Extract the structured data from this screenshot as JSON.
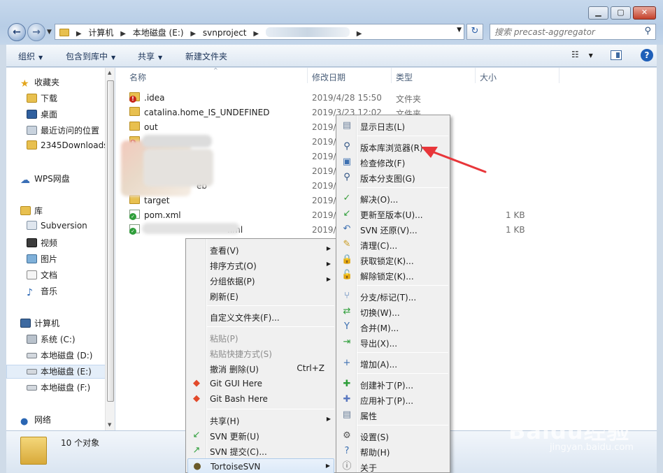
{
  "window": {
    "min": "▁",
    "max": "▢",
    "close": "✕"
  },
  "address": {
    "crumbs": [
      "计算机",
      "本地磁盘 (E:)",
      "svnproject"
    ],
    "search_placeholder": "搜索 precast-aggregator"
  },
  "toolbar": {
    "organize": "组织",
    "include": "包含到库中",
    "share": "共享",
    "new_folder": "新建文件夹"
  },
  "nav": {
    "favorites": "收藏夹",
    "downloads": "下载",
    "desktop": "桌面",
    "recent": "最近访问的位置",
    "dl2345": "2345Downloads",
    "wps": "WPS网盘",
    "libraries": "库",
    "subversion": "Subversion",
    "videos": "视频",
    "pictures": "图片",
    "documents": "文档",
    "music": "音乐",
    "computer": "计算机",
    "drive_c": "系统 (C:)",
    "drive_d": "本地磁盘 (D:)",
    "drive_e": "本地磁盘 (E:)",
    "drive_f": "本地磁盘 (F:)",
    "network": "网络"
  },
  "columns": {
    "name": "名称",
    "date": "修改日期",
    "type": "类型",
    "size": "大小"
  },
  "files": [
    {
      "name": ".idea",
      "date": "2019/4/28 15:50",
      "type": "文件夹",
      "size": "",
      "status": "modified"
    },
    {
      "name": "catalina.home_IS_UNDEFINED",
      "date": "2019/3/23 12:02",
      "type": "文件夹",
      "size": "",
      "status": "none"
    },
    {
      "name": "out",
      "date": "2019/",
      "type": "",
      "size": "",
      "status": "none"
    },
    {
      "name": "p",
      "date": "2019/",
      "type": "",
      "size": "",
      "status": "modified"
    },
    {
      "name": "",
      "date": "2019/",
      "type": "",
      "size": "",
      "status": "none"
    },
    {
      "name": "",
      "date": "2019/",
      "type": "",
      "size": "",
      "status": "none"
    },
    {
      "name": "eb",
      "date": "2019/",
      "type": "",
      "size": "",
      "status": "modified"
    },
    {
      "name": "target",
      "date": "2019/",
      "type": "",
      "size": "",
      "status": "none"
    },
    {
      "name": "pom.xml",
      "date": "2019/",
      "type": "",
      "size": "1 KB",
      "status": "ok"
    },
    {
      "name": ".iml",
      "date": "2019/",
      "type": "",
      "size": "1 KB",
      "status": "ok"
    }
  ],
  "details": {
    "count": "10 个对象"
  },
  "explorer_menu": [
    {
      "label": "查看(V)",
      "sub": true
    },
    {
      "label": "排序方式(O)",
      "sub": true
    },
    {
      "label": "分组依据(P)",
      "sub": true
    },
    {
      "label": "刷新(E)"
    },
    {
      "label": "自定义文件夹(F)..."
    },
    {
      "label": "粘贴(P)",
      "disabled": true
    },
    {
      "label": "粘贴快捷方式(S)",
      "disabled": true
    },
    {
      "label": "撤消 删除(U)",
      "shortcut": "Ctrl+Z"
    },
    {
      "label": "Git GUI Here"
    },
    {
      "label": "Git Bash Here"
    },
    {
      "label": "共享(H)",
      "sub": true
    },
    {
      "label": "SVN 更新(U)"
    },
    {
      "label": "SVN 提交(C)..."
    },
    {
      "label": "TortoiseSVN",
      "sub": true
    }
  ],
  "svn_menu": [
    {
      "label": "显示日志(L)"
    },
    {
      "label": "版本库浏览器(R)"
    },
    {
      "label": "检查修改(F)"
    },
    {
      "label": "版本分支图(G)"
    },
    {
      "label": "解决(O)..."
    },
    {
      "label": "更新至版本(U)..."
    },
    {
      "label": "SVN 还原(V)..."
    },
    {
      "label": "清理(C)..."
    },
    {
      "label": "获取锁定(K)..."
    },
    {
      "label": "解除锁定(K)..."
    },
    {
      "label": "分支/标记(T)..."
    },
    {
      "label": "切换(W)..."
    },
    {
      "label": "合并(M)..."
    },
    {
      "label": "导出(X)..."
    },
    {
      "label": "增加(A)..."
    },
    {
      "label": "创建补丁(P)..."
    },
    {
      "label": "应用补丁(P)..."
    },
    {
      "label": "属性"
    },
    {
      "label": "设置(S)"
    },
    {
      "label": "帮助(H)"
    },
    {
      "label": "关于"
    }
  ],
  "watermark": {
    "brand": "Baidu经验",
    "url": "jingyan.baidu.com"
  },
  "colors": {
    "accent": "#1f5fb8",
    "arrow": "#e8363a"
  }
}
